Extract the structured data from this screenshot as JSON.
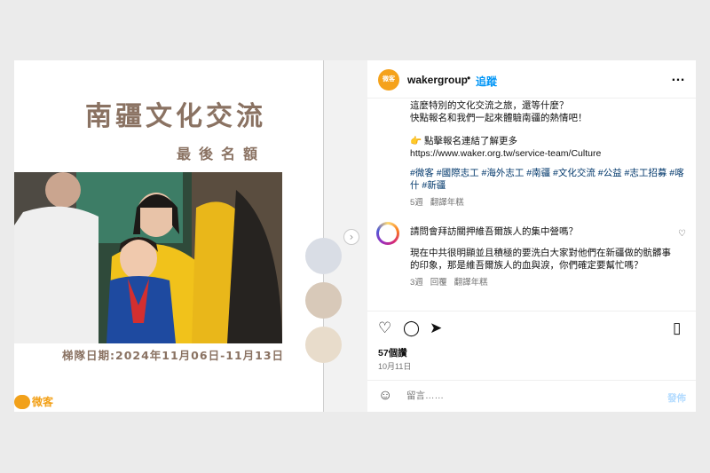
{
  "media": {
    "title": "南疆文化交流",
    "subtitle": "最後名額",
    "dates": "梯隊日期:2024年11月06日-11月13日",
    "logo_text": "微客",
    "swatches": [
      "#d9dde5",
      "#d8c9b9",
      "#e8dccb"
    ],
    "next_icon": "chevron-right-icon"
  },
  "header": {
    "avatar_text": "微客",
    "username": "wakergroup",
    "separator": "•",
    "follow_label": "追蹤",
    "more_icon": "…"
  },
  "caption": {
    "line1": "這麼特別的文化交流之旅，還等什麼？",
    "line2": "快點報名和我們一起來體驗南疆的熱情吧！",
    "line3_emoji": "👉",
    "line3": "點擊報名連結了解更多",
    "link": "https://www.waker.org.tw/service-team/Culture",
    "tags": "#微客 #國際志工 #海外志工 #南疆 #文化交流 #公益 #志工招募 #喀什 #新疆",
    "meta_time": "5週",
    "meta_translate": "翻譯年糕"
  },
  "comment": {
    "question": "請問會拜訪關押維吾爾族人的集中營嗎？",
    "body": "現在中共很明顯並且積極的要洗白大家對他們在新疆做的骯髒事的印象，那是維吾爾族人的血與淚，你們確定要幫忙嗎？",
    "meta_time": "3週",
    "meta_reply": "回覆",
    "meta_translate": "翻譯年糕"
  },
  "actions": {
    "likes": "57個讚",
    "date": "10月11日"
  },
  "comment_bar": {
    "placeholder": "留言……",
    "post_label": "發佈"
  }
}
